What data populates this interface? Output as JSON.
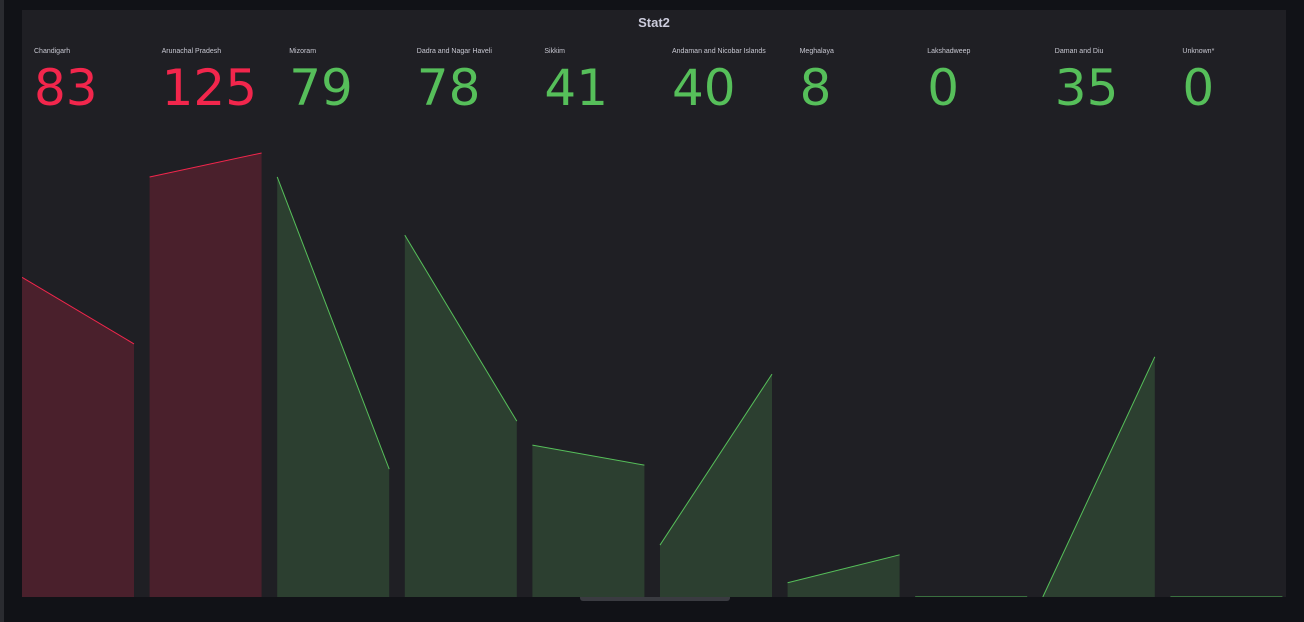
{
  "panel": {
    "title": "Stat2",
    "stats": [
      {
        "label": "Chandigarh",
        "value": "83",
        "color": "#f2264c",
        "fill": "#4a202c",
        "spark": [
          0.72,
          0.57
        ]
      },
      {
        "label": "Arunachal Pradesh",
        "value": "125",
        "color": "#f2264c",
        "fill": "#4a202c",
        "spark": [
          0.946,
          1.0
        ]
      },
      {
        "label": "Mizoram",
        "value": "79",
        "color": "#56bf5a",
        "fill": "#2c3f30",
        "spark": [
          0.946,
          0.288
        ]
      },
      {
        "label": "Dadra and Nagar Haveli",
        "value": "78",
        "color": "#56bf5a",
        "fill": "#2c3f30",
        "spark": [
          0.815,
          0.396
        ]
      },
      {
        "label": "Sikkim",
        "value": "41",
        "color": "#56bf5a",
        "fill": "#2c3f30",
        "spark": [
          0.342,
          0.297
        ]
      },
      {
        "label": "Andaman and Nicobar Islands",
        "value": "40",
        "color": "#56bf5a",
        "fill": "#2c3f30",
        "spark": [
          0.117,
          0.502
        ]
      },
      {
        "label": "Meghalaya",
        "value": "8",
        "color": "#56bf5a",
        "fill": "#2c3f30",
        "spark": [
          0.032,
          0.095
        ]
      },
      {
        "label": "Lakshadweep",
        "value": "0",
        "color": "#56bf5a",
        "fill": "#2c3f30",
        "spark": [
          0.0,
          0.0
        ]
      },
      {
        "label": "Daman and Diu",
        "value": "35",
        "color": "#56bf5a",
        "fill": "#2c3f30",
        "spark": [
          0.0,
          0.541
        ]
      },
      {
        "label": "Unknown*",
        "value": "0",
        "color": "#56bf5a",
        "fill": "#2c3f30",
        "spark": [
          0.0,
          0.0
        ]
      }
    ]
  }
}
